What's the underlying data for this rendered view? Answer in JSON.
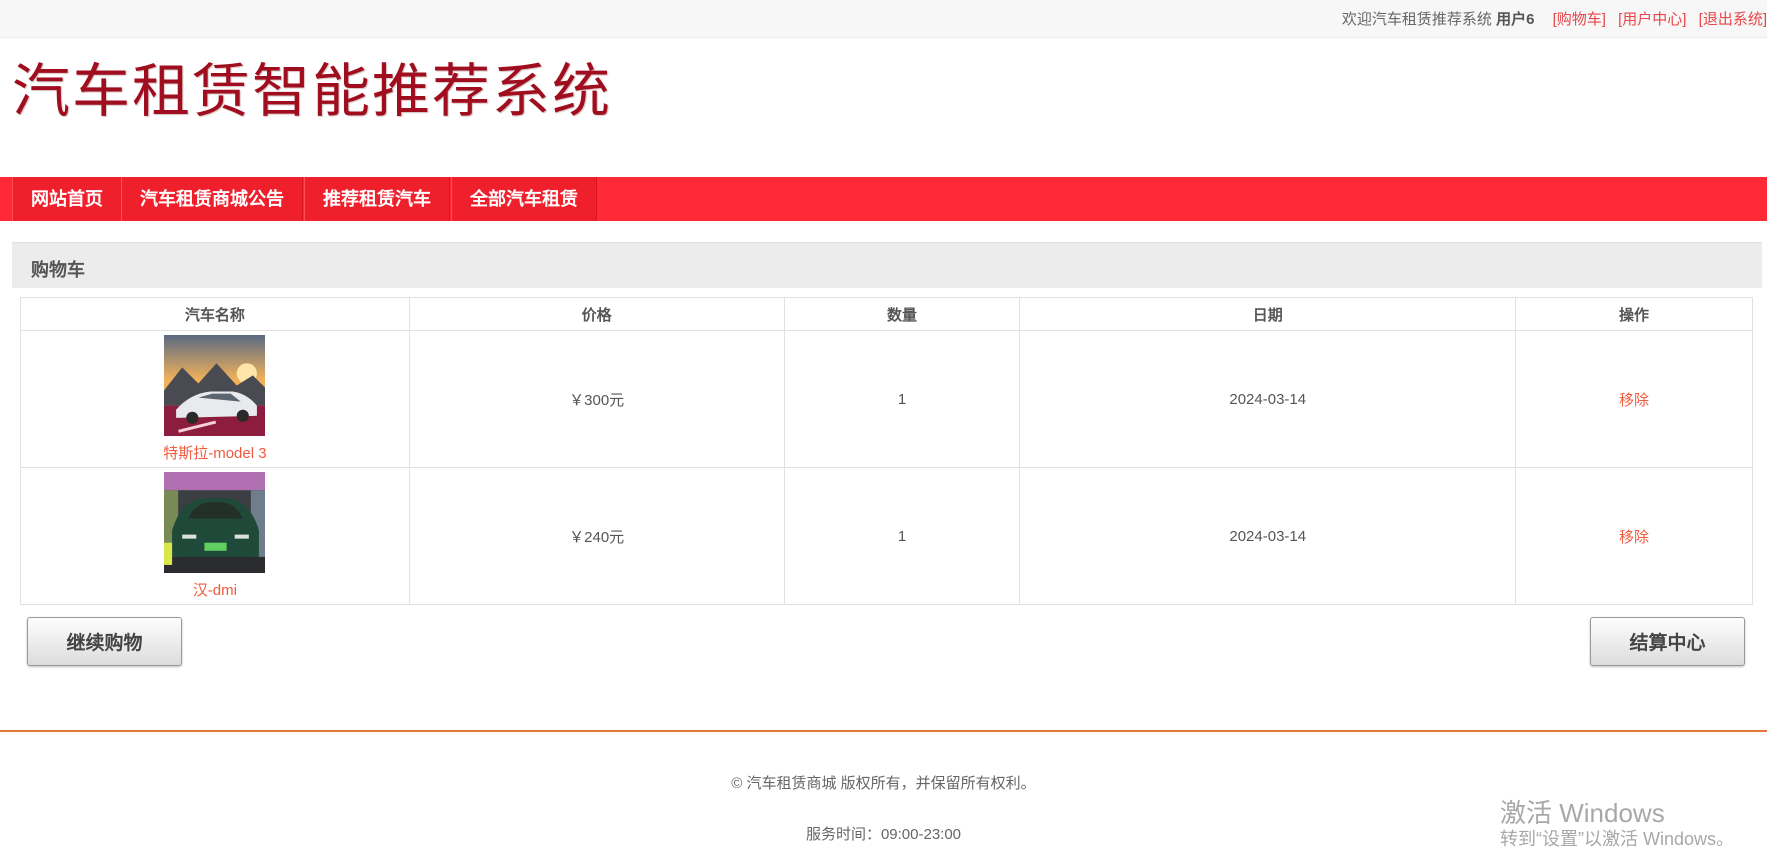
{
  "topbar": {
    "welcome": "欢迎汽车租赁推荐系统",
    "username": "用户6",
    "cart_link": "[购物车]",
    "user_center_link": "[用户中心]",
    "logout_link": "[退出系统]"
  },
  "header": {
    "title": "汽车租赁智能推荐系统",
    "title_color": "#a00d1e"
  },
  "nav": {
    "items": [
      {
        "label": "网站首页"
      },
      {
        "label": "汽车租赁商城公告"
      },
      {
        "label": "推荐租赁汽车"
      },
      {
        "label": "全部汽车租赁"
      }
    ],
    "background_color": "#ff2a35"
  },
  "cart": {
    "section_title": "购物车",
    "columns": [
      "汽车名称",
      "价格",
      "数量",
      "日期",
      "操作"
    ],
    "rows": [
      {
        "name": "特斯拉-model 3",
        "image_icon": "car-photo-white-sedan",
        "price": "￥300元",
        "quantity": "1",
        "date": "2024-03-14",
        "action": "移除"
      },
      {
        "name": "汉-dmi",
        "image_icon": "car-photo-green-sedan",
        "price": "￥240元",
        "quantity": "1",
        "date": "2024-03-14",
        "action": "移除"
      }
    ],
    "continue_button": "继续购物",
    "checkout_button": "结算中心"
  },
  "footer": {
    "copyright": "© 汽车租赁商城 版权所有，并保留所有权利。",
    "service_hours": "服务时间：09:00-23:00"
  },
  "watermark": {
    "title": "激活 Windows",
    "subtitle": "转到“设置”以激活 Windows。"
  },
  "colors": {
    "accent": "#f05a3e",
    "footer_line": "#e3773a"
  }
}
